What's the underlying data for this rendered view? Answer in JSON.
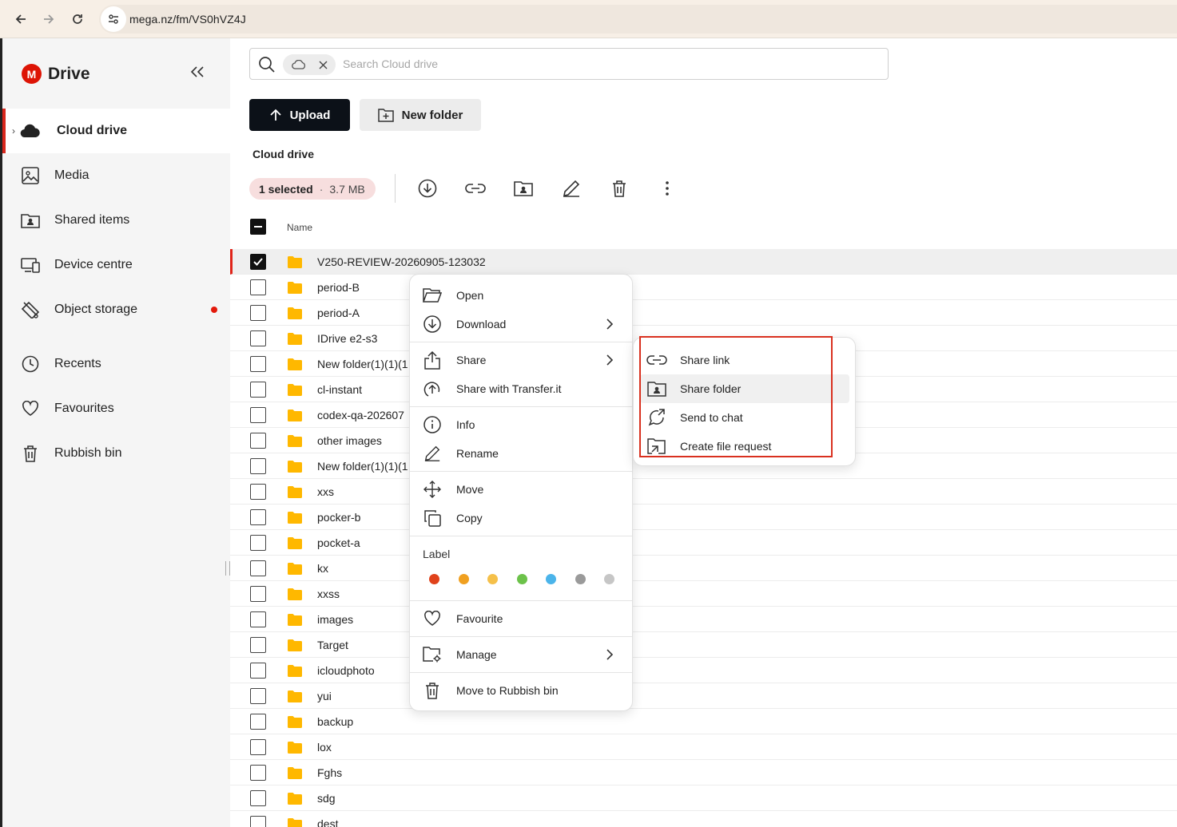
{
  "browser": {
    "url": "mega.nz/fm/VS0hVZ4J"
  },
  "sidebar": {
    "brand_letter": "M",
    "brand_name": "Drive",
    "items": [
      {
        "label": "Cloud drive",
        "icon": "cloud-icon",
        "active": true
      },
      {
        "label": "Media",
        "icon": "image-icon"
      },
      {
        "label": "Shared items",
        "icon": "shared-folder-icon"
      },
      {
        "label": "Device centre",
        "icon": "devices-icon"
      },
      {
        "label": "Object storage",
        "icon": "object-storage-icon",
        "badge": "red-dot"
      },
      {
        "label": "Recents",
        "icon": "clock-icon"
      },
      {
        "label": "Favourites",
        "icon": "heart-icon"
      },
      {
        "label": "Rubbish bin",
        "icon": "trash-icon"
      }
    ]
  },
  "search": {
    "chip_icon": "cloud-icon",
    "placeholder": "Search Cloud drive"
  },
  "actions": {
    "upload_label": "Upload",
    "new_folder_label": "New folder"
  },
  "breadcrumb": "Cloud drive",
  "selection": {
    "count_label": "1 selected",
    "separator": "·",
    "size": "3.7 MB"
  },
  "toolbar_icons": [
    "download-icon",
    "link-icon",
    "share-folder-icon",
    "rename-icon",
    "trash-icon",
    "more-icon"
  ],
  "table": {
    "column_name": "Name",
    "rows": [
      {
        "name": "V250-REVIEW-20260905-123032",
        "selected": true
      },
      {
        "name": "period-B"
      },
      {
        "name": "period-A"
      },
      {
        "name": "IDrive e2-s3"
      },
      {
        "name": "New folder(1)(1)(1"
      },
      {
        "name": "cl-instant"
      },
      {
        "name": "codex-qa-202607"
      },
      {
        "name": "other images"
      },
      {
        "name": "New folder(1)(1)(1"
      },
      {
        "name": "xxs"
      },
      {
        "name": "pocker-b"
      },
      {
        "name": "pocket-a"
      },
      {
        "name": "kx"
      },
      {
        "name": "xxss"
      },
      {
        "name": "images"
      },
      {
        "name": "Target"
      },
      {
        "name": "icloudphoto"
      },
      {
        "name": "yui"
      },
      {
        "name": "backup"
      },
      {
        "name": "lox"
      },
      {
        "name": "Fghs"
      },
      {
        "name": "sdg"
      },
      {
        "name": "dest"
      }
    ]
  },
  "context_menu": {
    "open": "Open",
    "download": "Download",
    "share": "Share",
    "share_transfer": "Share with Transfer.it",
    "info": "Info",
    "rename": "Rename",
    "move": "Move",
    "copy": "Copy",
    "label_title": "Label",
    "label_colors": [
      "#e0421b",
      "#f0a020",
      "#f5c04a",
      "#6cc24a",
      "#4bb4ea",
      "#9a9a9a",
      "#c6c6c6"
    ],
    "favourite": "Favourite",
    "manage": "Manage",
    "move_to_bin": "Move to Rubbish bin"
  },
  "share_submenu": {
    "share_link": "Share link",
    "share_folder": "Share folder",
    "send_to_chat": "Send to chat",
    "create_file_request": "Create file request"
  },
  "colors": {
    "brand_red": "#dd1405",
    "highlight_red": "#d9301f",
    "folder_yellow": "#ffb800",
    "upload_bg": "#0c1118"
  }
}
